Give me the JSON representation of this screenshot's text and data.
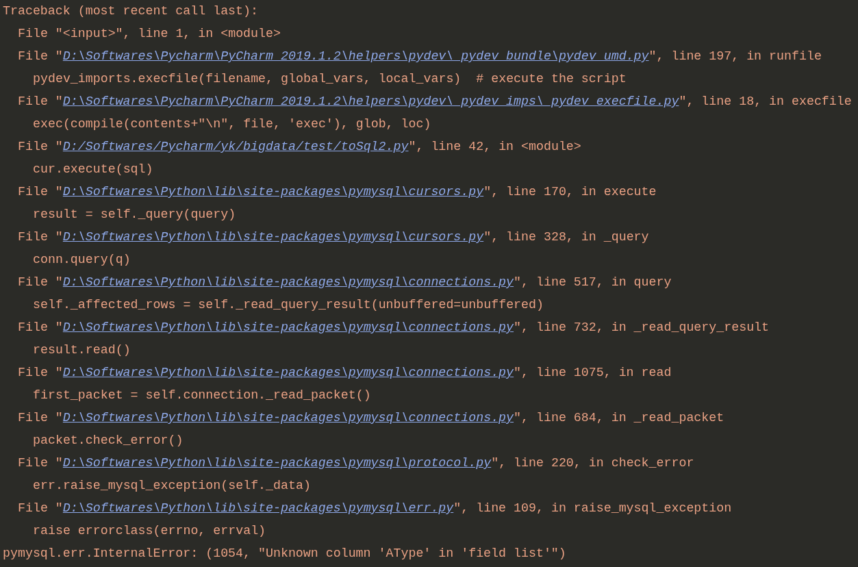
{
  "console": {
    "header": "Traceback (most recent call last):",
    "frames": [
      {
        "kind": "plain",
        "text": "File \"<input>\", line 1, in <module>"
      },
      {
        "kind": "link",
        "lead": "File \"",
        "path": "D:\\Softwares\\Pycharm\\PyCharm 2019.1.2\\helpers\\pydev\\_pydev_bundle\\pydev_umd.py",
        "tail": "\", line 197, in runfile",
        "code": "pydev_imports.execfile(filename, global_vars, local_vars)  # execute the script"
      },
      {
        "kind": "link",
        "lead": "File \"",
        "path": "D:\\Softwares\\Pycharm\\PyCharm 2019.1.2\\helpers\\pydev\\_pydev_imps\\_pydev_execfile.py",
        "tail": "\", line 18, in execfile",
        "code": "exec(compile(contents+\"\\n\", file, 'exec'), glob, loc)"
      },
      {
        "kind": "link",
        "lead": "File \"",
        "path": "D:/Softwares/Pycharm/yk/bigdata/test/toSql2.py",
        "tail": "\", line 42, in <module>",
        "code": "cur.execute(sql)"
      },
      {
        "kind": "link",
        "lead": "File \"",
        "path": "D:\\Softwares\\Python\\lib\\site-packages\\pymysql\\cursors.py",
        "tail": "\", line 170, in execute",
        "code": "result = self._query(query)"
      },
      {
        "kind": "link",
        "lead": "File \"",
        "path": "D:\\Softwares\\Python\\lib\\site-packages\\pymysql\\cursors.py",
        "tail": "\", line 328, in _query",
        "code": "conn.query(q)"
      },
      {
        "kind": "link",
        "lead": "File \"",
        "path": "D:\\Softwares\\Python\\lib\\site-packages\\pymysql\\connections.py",
        "tail": "\", line 517, in query",
        "code": "self._affected_rows = self._read_query_result(unbuffered=unbuffered)"
      },
      {
        "kind": "link",
        "lead": "File \"",
        "path": "D:\\Softwares\\Python\\lib\\site-packages\\pymysql\\connections.py",
        "tail": "\", line 732, in _read_query_result",
        "code": "result.read()"
      },
      {
        "kind": "link",
        "lead": "File \"",
        "path": "D:\\Softwares\\Python\\lib\\site-packages\\pymysql\\connections.py",
        "tail": "\", line 1075, in read",
        "code": "first_packet = self.connection._read_packet()"
      },
      {
        "kind": "link",
        "lead": "File \"",
        "path": "D:\\Softwares\\Python\\lib\\site-packages\\pymysql\\connections.py",
        "tail": "\", line 684, in _read_packet",
        "code": "packet.check_error()"
      },
      {
        "kind": "link",
        "lead": "File \"",
        "path": "D:\\Softwares\\Python\\lib\\site-packages\\pymysql\\protocol.py",
        "tail": "\", line 220, in check_error",
        "code": "err.raise_mysql_exception(self._data)"
      },
      {
        "kind": "link",
        "lead": "File \"",
        "path": "D:\\Softwares\\Python\\lib\\site-packages\\pymysql\\err.py",
        "tail": "\", line 109, in raise_mysql_exception",
        "code": "raise errorclass(errno, errval)"
      }
    ],
    "error": "pymysql.err.InternalError: (1054, \"Unknown column 'AType' in 'field list'\")"
  }
}
